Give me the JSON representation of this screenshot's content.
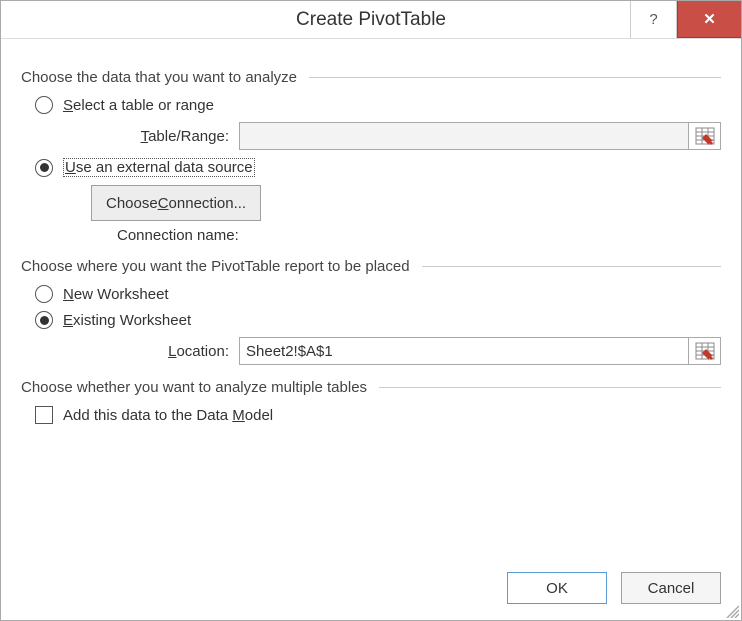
{
  "title": "Create PivotTable",
  "section1": {
    "header": "Choose the data that you want to analyze",
    "option_select_range": "Select a table or range",
    "table_range_label": "Table/Range:",
    "table_range_value": "",
    "option_external": "Use an external data source",
    "choose_connection_btn": "Choose Connection...",
    "connection_name_label": "Connection name:"
  },
  "section2": {
    "header": "Choose where you want the PivotTable report to be placed",
    "option_new_ws": "New Worksheet",
    "option_existing_ws": "Existing Worksheet",
    "location_label": "Location:",
    "location_value": "Sheet2!$A$1"
  },
  "section3": {
    "header": "Choose whether you want to analyze multiple tables",
    "checkbox_label": "Add this data to the Data Model"
  },
  "buttons": {
    "ok": "OK",
    "cancel": "Cancel"
  }
}
